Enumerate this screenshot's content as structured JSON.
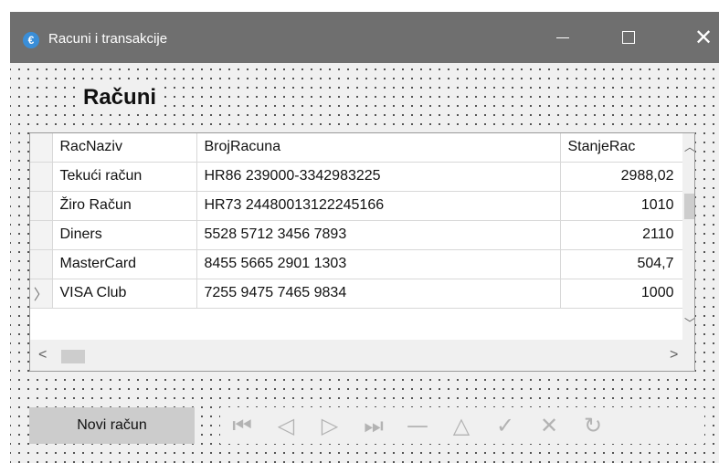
{
  "window": {
    "title": "Racuni i transakcije",
    "icon": "euro-icon",
    "icon_glyph": "€",
    "minimize_glyph": "",
    "close_glyph": "✕"
  },
  "form": {
    "heading": "Računi"
  },
  "grid": {
    "columns": [
      "RacNaziv",
      "BrojRacuna",
      "StanjeRac"
    ],
    "rows": [
      {
        "naziv": "Tekući račun",
        "broj": "HR86 239000-3342983225",
        "stanje": "2988,02",
        "current": false
      },
      {
        "naziv": "Žiro Račun",
        "broj": "HR73 24480013122245166",
        "stanje": "1010",
        "current": false
      },
      {
        "naziv": "Diners",
        "broj": "5528 5712 3456 7893",
        "stanje": "2110",
        "current": false
      },
      {
        "naziv": "MasterCard",
        "broj": "8455 5665 2901 1303",
        "stanje": "504,7",
        "current": false
      },
      {
        "naziv": "VISA Club",
        "broj": "7255 9475 7465 9834",
        "stanje": "1000",
        "current": true
      }
    ],
    "current_row_glyph": "〉",
    "scroll": {
      "up": "︿",
      "down": "﹀",
      "left": "<",
      "right": ">"
    }
  },
  "toolbar": {
    "new_label": "Novi račun",
    "nav_buttons": [
      {
        "name": "first-record-icon",
        "glyph": "⏮"
      },
      {
        "name": "previous-record-icon",
        "glyph": "◁"
      },
      {
        "name": "next-record-icon",
        "glyph": "▷"
      },
      {
        "name": "last-record-icon",
        "glyph": "⏭"
      },
      {
        "name": "delete-record-icon",
        "glyph": "—"
      },
      {
        "name": "edit-record-icon",
        "glyph": "△"
      },
      {
        "name": "post-record-icon",
        "glyph": "✓"
      },
      {
        "name": "cancel-record-icon",
        "glyph": "✕"
      },
      {
        "name": "refresh-icon",
        "glyph": "↻"
      }
    ]
  },
  "colors": {
    "titlebar": "#6f6f6f",
    "client_bg": "#f0f0f0",
    "button_bg": "#cccccc",
    "disabled_icon": "#b3b3b3"
  }
}
